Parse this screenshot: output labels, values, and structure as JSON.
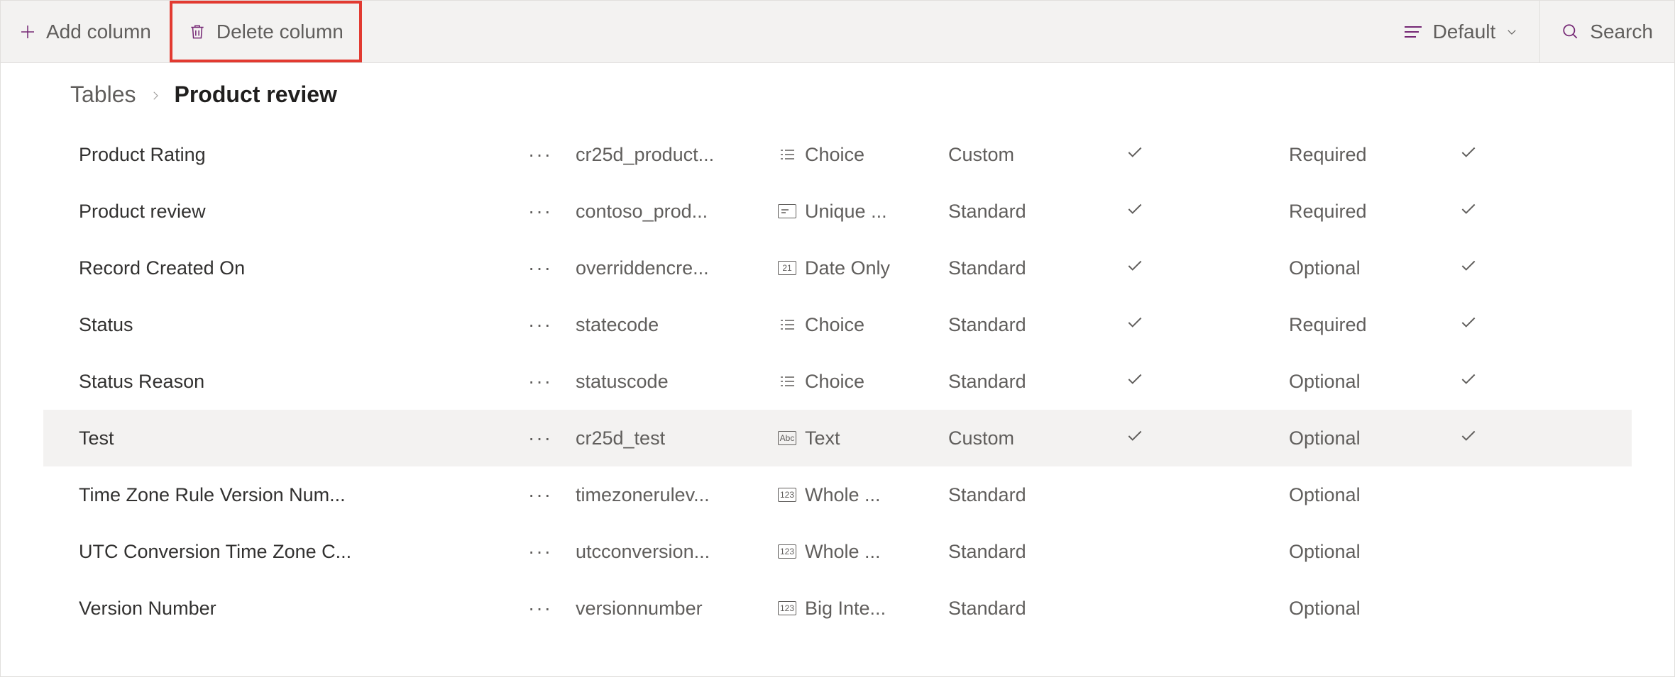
{
  "commandbar": {
    "add_column": "Add column",
    "delete_column": "Delete column",
    "view_label": "Default",
    "search_label": "Search"
  },
  "breadcrumb": {
    "parent": "Tables",
    "current": "Product review"
  },
  "rows": [
    {
      "display": "Product Rating",
      "name": "cr25d_product...",
      "type_icon": "choice",
      "type": "Choice",
      "mode": "Custom",
      "chk1": true,
      "required": "Required",
      "chk2": true,
      "selected": false
    },
    {
      "display": "Product review",
      "name": "contoso_prod...",
      "type_icon": "unique",
      "type": "Unique ...",
      "mode": "Standard",
      "chk1": true,
      "required": "Required",
      "chk2": true,
      "selected": false
    },
    {
      "display": "Record Created On",
      "name": "overriddencre...",
      "type_icon": "date",
      "type": "Date Only",
      "mode": "Standard",
      "chk1": true,
      "required": "Optional",
      "chk2": true,
      "selected": false
    },
    {
      "display": "Status",
      "name": "statecode",
      "type_icon": "choice",
      "type": "Choice",
      "mode": "Standard",
      "chk1": true,
      "required": "Required",
      "chk2": true,
      "selected": false
    },
    {
      "display": "Status Reason",
      "name": "statuscode",
      "type_icon": "choice",
      "type": "Choice",
      "mode": "Standard",
      "chk1": true,
      "required": "Optional",
      "chk2": true,
      "selected": false
    },
    {
      "display": "Test",
      "name": "cr25d_test",
      "type_icon": "text",
      "type": "Text",
      "mode": "Custom",
      "chk1": true,
      "required": "Optional",
      "chk2": true,
      "selected": true
    },
    {
      "display": "Time Zone Rule Version Num...",
      "name": "timezonerulev...",
      "type_icon": "number",
      "type": "Whole ...",
      "mode": "Standard",
      "chk1": false,
      "required": "Optional",
      "chk2": false,
      "selected": false
    },
    {
      "display": "UTC Conversion Time Zone C...",
      "name": "utcconversion...",
      "type_icon": "number",
      "type": "Whole ...",
      "mode": "Standard",
      "chk1": false,
      "required": "Optional",
      "chk2": false,
      "selected": false
    },
    {
      "display": "Version Number",
      "name": "versionnumber",
      "type_icon": "number",
      "type": "Big Inte...",
      "mode": "Standard",
      "chk1": false,
      "required": "Optional",
      "chk2": false,
      "selected": false
    }
  ]
}
